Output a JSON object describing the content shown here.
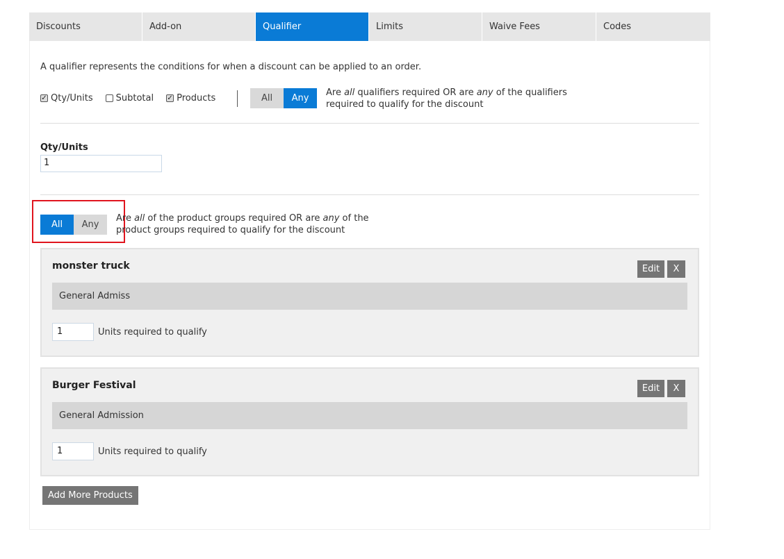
{
  "tabs": [
    {
      "label": "Discounts",
      "active": false
    },
    {
      "label": "Add-on",
      "active": false
    },
    {
      "label": "Qualifier",
      "active": true
    },
    {
      "label": "Limits",
      "active": false
    },
    {
      "label": "Waive Fees",
      "active": false
    },
    {
      "label": "Codes",
      "active": false
    }
  ],
  "intro": "A qualifier represents the conditions for when a discount can be applied to an order.",
  "qualifiers": {
    "checkboxes": [
      {
        "label": "Qty/Units",
        "checked": true
      },
      {
        "label": "Subtotal",
        "checked": false
      },
      {
        "label": "Products",
        "checked": true
      }
    ],
    "toggle": {
      "all": "All",
      "any": "Any",
      "selected": "Any"
    },
    "hint_pre": "Are ",
    "hint_all": "all",
    "hint_mid": " qualifiers required OR are ",
    "hint_any": "any",
    "hint_post": " of the qualifiers",
    "hint_line2": "required to qualify for the discount"
  },
  "qty": {
    "label": "Qty/Units",
    "value": "1"
  },
  "product_groups": {
    "toggle": {
      "all": "All",
      "any": "Any",
      "selected": "All"
    },
    "hint_pre": "Are ",
    "hint_all": "all",
    "hint_mid": " of the product groups required OR are ",
    "hint_any": "any",
    "hint_post": " of the",
    "hint_line2": "product groups required to qualify for the discount"
  },
  "groups": [
    {
      "title": "monster truck",
      "product": "General Admiss",
      "units": "1",
      "units_label": "Units required to qualify",
      "edit": "Edit",
      "remove": "X"
    },
    {
      "title": "Burger Festival",
      "product": "General Admission",
      "units": "1",
      "units_label": "Units required to qualify",
      "edit": "Edit",
      "remove": "X"
    }
  ],
  "add_more": "Add More Products",
  "colors": {
    "accent": "#0a7bd6",
    "highlight": "#e0141e",
    "button_gray": "#757575"
  }
}
